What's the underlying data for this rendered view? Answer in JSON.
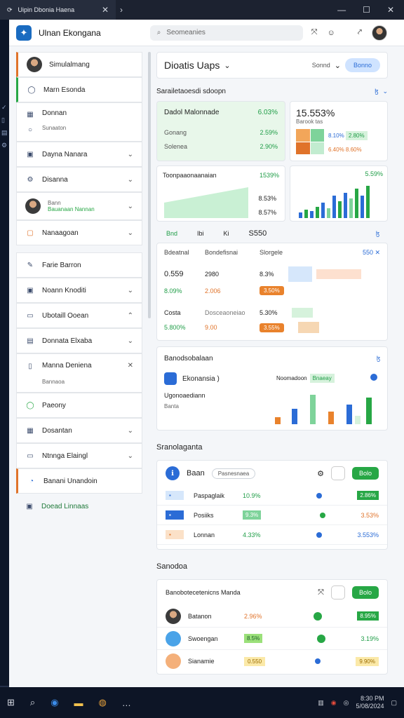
{
  "window": {
    "tab_title": "Uipin Dbonia Haena",
    "tab_close": "✕",
    "new_tab": "›",
    "minimize": "—",
    "maximize": "☐",
    "close": "✕"
  },
  "header": {
    "title": "Ulnan Ekongana",
    "search_placeholder": "Seomeanies"
  },
  "sidebar": {
    "items": [
      {
        "label": "Simulalmang"
      },
      {
        "label": "Marn Esonda"
      },
      {
        "label": "Donnan",
        "sub": "Sunaaton"
      },
      {
        "label": "Dayna Nanara"
      },
      {
        "label": "Disanna"
      },
      {
        "label": "Bann",
        "sub": "Bauanaan Nannan"
      },
      {
        "label": "Nanaagoan"
      },
      {
        "label": "Farie Barron"
      },
      {
        "label": "Noann Knoditi"
      },
      {
        "label": "Ubotaill Ooean"
      },
      {
        "label": "Donnata Elxaba"
      },
      {
        "label": "Manna Deniena",
        "sub": "Bannaoa"
      },
      {
        "label": "Paeony"
      },
      {
        "label": "Dosantan"
      },
      {
        "label": "Ntnnga Elaingl"
      },
      {
        "label": "Banani Unandoin"
      },
      {
        "label": "Doead Linnaas"
      }
    ]
  },
  "top": {
    "title": "Dioatis Uaps",
    "sort": "Sonnd",
    "button": "Bonno"
  },
  "section1": {
    "title": "Sarailetaoesdi sdoopn",
    "right": "ɮ"
  },
  "kpi": {
    "a_title": "Dadol Malonnade",
    "a_val": "6.03%",
    "a_r1": "Gonang",
    "a_r1v": "2.59%",
    "a_r2": "Solenea",
    "a_r2v": "2.90%",
    "b_title": "15.553%",
    "b_sub": "Barook tas",
    "b_r1": "8.10%",
    "b_r1b": "2.80%",
    "b_r2": "6.40%",
    "b_r2b": "8.60%",
    "c_title": "Toonpaaonaanaian",
    "c_v1": "1539%",
    "c_v2": "8.53%",
    "c_v3": "8.57%",
    "d_v": "5.59%"
  },
  "row_labels": {
    "a": "Bnd",
    "b": "Ibi",
    "c": "Ki",
    "d": "S550",
    "e": "ɮ"
  },
  "table1": {
    "head": [
      "Bdeatnal",
      "Bondefisnai",
      "Slorgele"
    ],
    "right": "550 ✕",
    "r1": [
      "0.559",
      "2980",
      "8.3%"
    ],
    "r1b": [
      "8.09%",
      "2.006",
      "3.50%"
    ],
    "r2": [
      "Costa",
      "Dosceaoneiao",
      "5.30%"
    ],
    "r2b": [
      "5.800%",
      "9.00",
      "3.55%"
    ]
  },
  "analytics": {
    "title": "Banodsobalaan",
    "right": "ɮ",
    "brand": "Ekonansia )",
    "sub": "Ugonoaediann",
    "meta": "Banta",
    "legend": "Noomadoon",
    "legend_tag": "Bnaeay"
  },
  "section2": {
    "title": "Sranolaganta",
    "btn": "Baan",
    "pill": "Pasnesnaea",
    "action": "Bolo",
    "rows": [
      [
        "Paspaglaik",
        "10.9%",
        "2.86%"
      ],
      [
        "Posiiks",
        "9.3%",
        "3.53%"
      ],
      [
        "Lonnan",
        "4.33%",
        "3.553%"
      ]
    ]
  },
  "section3": {
    "title": "Sanodoa",
    "sub": "Banobotecetenicns Manda",
    "action": "Bolo",
    "rows": [
      [
        "Batanon",
        "2.96%",
        "8.95%"
      ],
      [
        "Swoengan",
        "8.5%",
        "3.19%"
      ],
      [
        "Sianamie",
        "0.550",
        "9.90%"
      ]
    ]
  },
  "taskbar": {
    "time": "8:30 PM",
    "date": "5/08/2024"
  }
}
